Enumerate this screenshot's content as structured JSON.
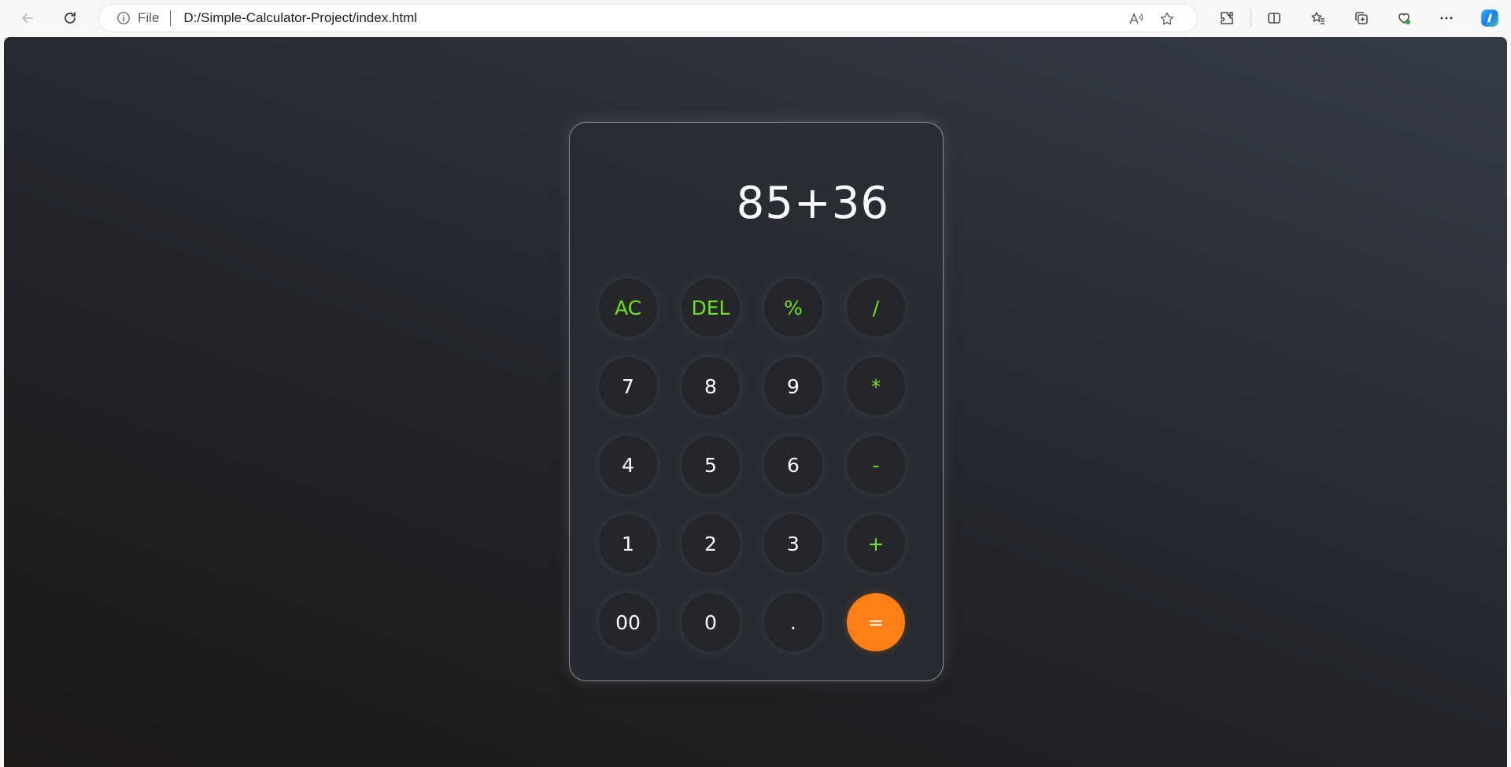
{
  "browser": {
    "file_label": "File",
    "url": "D:/Simple-Calculator-Project/index.html"
  },
  "calculator": {
    "display": "85+36",
    "keys": [
      {
        "label": "AC",
        "type": "op",
        "name": "clear-all-button"
      },
      {
        "label": "DEL",
        "type": "op",
        "name": "delete-button"
      },
      {
        "label": "%",
        "type": "op",
        "name": "percent-button"
      },
      {
        "label": "/",
        "type": "op",
        "name": "divide-button"
      },
      {
        "label": "7",
        "type": "num",
        "name": "digit-7-button"
      },
      {
        "label": "8",
        "type": "num",
        "name": "digit-8-button"
      },
      {
        "label": "9",
        "type": "num",
        "name": "digit-9-button"
      },
      {
        "label": "*",
        "type": "op",
        "name": "multiply-button"
      },
      {
        "label": "4",
        "type": "num",
        "name": "digit-4-button"
      },
      {
        "label": "5",
        "type": "num",
        "name": "digit-5-button"
      },
      {
        "label": "6",
        "type": "num",
        "name": "digit-6-button"
      },
      {
        "label": "-",
        "type": "op",
        "name": "subtract-button"
      },
      {
        "label": "1",
        "type": "num",
        "name": "digit-1-button"
      },
      {
        "label": "2",
        "type": "num",
        "name": "digit-2-button"
      },
      {
        "label": "3",
        "type": "num",
        "name": "digit-3-button"
      },
      {
        "label": "+",
        "type": "op",
        "name": "add-button"
      },
      {
        "label": "00",
        "type": "num",
        "name": "double-zero-button"
      },
      {
        "label": "0",
        "type": "num",
        "name": "digit-0-button"
      },
      {
        "label": ".",
        "type": "num",
        "name": "decimal-button"
      },
      {
        "label": "=",
        "type": "eq",
        "name": "equals-button"
      }
    ]
  },
  "colors": {
    "operator": "#6fe319",
    "equals": "#fd7f16"
  }
}
